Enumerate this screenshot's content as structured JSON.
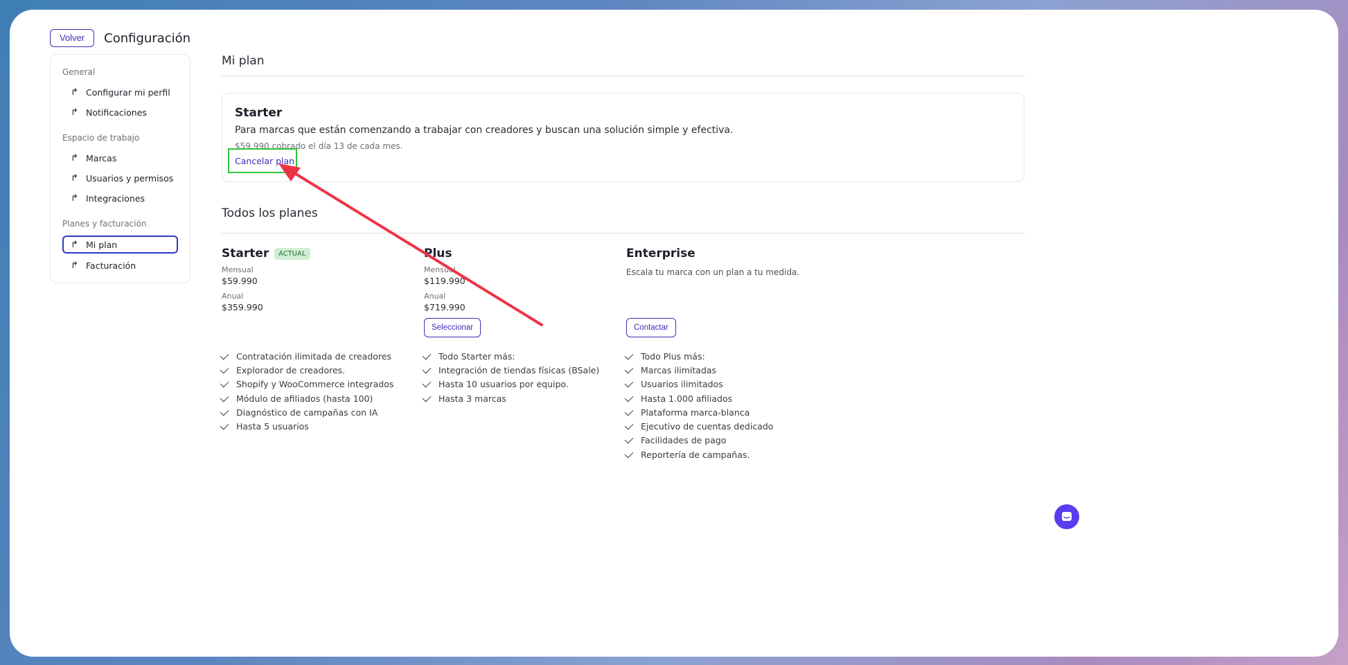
{
  "topbar": {
    "back_label": "Volver",
    "title": "Configuración"
  },
  "sidebar": {
    "sections": [
      {
        "label": "General",
        "items": [
          {
            "label": "Configurar mi perfil"
          },
          {
            "label": "Notificaciones"
          }
        ]
      },
      {
        "label": "Espacio de trabajo",
        "items": [
          {
            "label": "Marcas"
          },
          {
            "label": "Usuarios y permisos"
          },
          {
            "label": "Integraciones"
          }
        ]
      },
      {
        "label": "Planes y facturación",
        "items": [
          {
            "label": "Mi plan",
            "active": true
          },
          {
            "label": "Facturación"
          }
        ]
      }
    ]
  },
  "my_plan": {
    "heading": "Mi plan",
    "name": "Starter",
    "description": "Para marcas que están comenzando a trabajar con creadores y buscan una solución simple y efectiva.",
    "billing": "$59.990 cobrado el día 13 de cada mes.",
    "cancel_label": "Cancelar plan"
  },
  "all_plans": {
    "heading": "Todos los planes",
    "plans": [
      {
        "name": "Starter",
        "badge": "ACTUAL",
        "monthly_label": "Mensual",
        "monthly": "$59.990",
        "annual_label": "Anual",
        "annual": "$359.990",
        "features": [
          "Contratación ilimitada de creadores",
          "Explorador de creadores.",
          "Shopify y WooCommerce integrados",
          "Módulo de afiliados (hasta 100)",
          "Diagnóstico de campañas con IA",
          "Hasta 5 usuarios"
        ]
      },
      {
        "name": "Plus",
        "monthly_label": "Mensual",
        "monthly": "$119.990",
        "annual_label": "Anual",
        "annual": "$719.990",
        "button": "Seleccionar",
        "features": [
          "Todo Starter más:",
          "Integración de tiendas físicas (BSale)",
          "Hasta 10 usuarios por equipo.",
          "Hasta 3 marcas"
        ]
      },
      {
        "name": "Enterprise",
        "description": "Escala tu marca con un plan a tu medida.",
        "button": "Contactar",
        "features": [
          "Todo Plus más:",
          "Marcas ilimitadas",
          "Usuarios ilimitados",
          "Hasta 1.000 afiliados",
          "Plataforma marca-blanca",
          "Ejecutivo de cuentas dedicado",
          "Facilidades de pago",
          "Reportería de campañas."
        ]
      }
    ]
  },
  "colors": {
    "accent": "#3b2db8",
    "highlight": "#2fc43a",
    "arrow": "#ee3344",
    "chat": "#5b3cf0"
  },
  "icons": {
    "nav": "share-arrow-icon",
    "check": "check-icon",
    "chat": "chat-icon"
  }
}
